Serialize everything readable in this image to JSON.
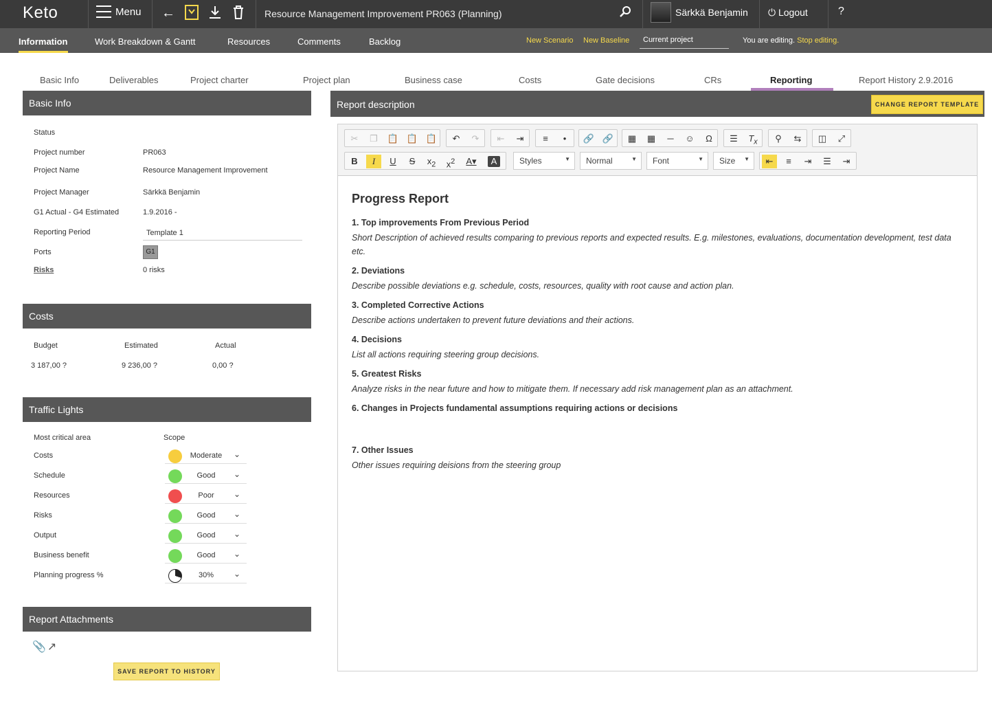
{
  "app": {
    "logo": "Keto",
    "menu_label": "Menu",
    "document_title": "Resource Management Improvement  PR063 (Planning)",
    "user_name": "Särkkä Benjamin",
    "logout_label": "Logout",
    "help_label": "?"
  },
  "nav": {
    "items": [
      "Information",
      "Work Breakdown & Gantt",
      "Resources",
      "Comments",
      "Backlog"
    ],
    "new_scenario": "New Scenario",
    "new_baseline": "New Baseline",
    "current_project": "Current project",
    "editing_text": "You are editing.",
    "stop_editing": "Stop editing."
  },
  "subtabs": [
    "Basic Info",
    "Deliverables",
    "Project charter",
    "Project plan",
    "Business case",
    "Costs",
    "Gate decisions",
    "CRs",
    "Reporting",
    "Report History 2.9.2016"
  ],
  "basic_info": {
    "title": "Basic Info",
    "status_label": "Status",
    "project_number_label": "Project number",
    "project_number": "PR063",
    "project_name_label": "Project Name",
    "project_name": "Resource Management Improvement",
    "project_manager_label": "Project Manager",
    "project_manager": "Särkkä Benjamin",
    "g1_label": "G1 Actual - G4 Estimated",
    "g1_value": "1.9.2016 -",
    "reporting_period_label": "Reporting Period",
    "reporting_period": "Template 1",
    "ports_label": "Ports",
    "port": "G1",
    "risks_label": "Risks",
    "risks_value": "0 risks"
  },
  "costs": {
    "title": "Costs",
    "budget_label": "Budget",
    "estimated_label": "Estimated",
    "actual_label": "Actual",
    "budget": "3 187,00 ?",
    "estimated": "9 236,00 ?",
    "actual": "0,00 ?"
  },
  "traffic": {
    "title": "Traffic Lights",
    "area_header": "Most critical area",
    "scope_header": "Scope",
    "rows": [
      {
        "label": "Costs",
        "value": "Moderate",
        "color": "#f7cd3e"
      },
      {
        "label": "Schedule",
        "value": "Good",
        "color": "#74d95a"
      },
      {
        "label": "Resources",
        "value": "Poor",
        "color": "#f04e4e"
      },
      {
        "label": "Risks",
        "value": "Good",
        "color": "#74d95a"
      },
      {
        "label": "Output",
        "value": "Good",
        "color": "#74d95a"
      },
      {
        "label": "Business benefit",
        "value": "Good",
        "color": "#74d95a"
      }
    ],
    "progress_label": "Planning progress %",
    "progress_value": "30%",
    "progress_fraction": 0.3
  },
  "attachments": {
    "title": "Report Attachments",
    "save_label": "SAVE REPORT TO HISTORY"
  },
  "report": {
    "title": "Report description",
    "change_template_label": "CHANGE REPORT TEMPLATE",
    "styles_label": "Styles",
    "format_label": "Normal",
    "font_label": "Font",
    "size_label": "Size",
    "heading": "Progress Report",
    "sections": [
      {
        "title": "1. Top improvements From Previous Period",
        "text": "Short Description of achieved results comparing to previous reports and expected results. E.g. milestones, evaluations, documentation development, test data etc."
      },
      {
        "title": "2. Deviations",
        "text": "Describe possible deviations e.g. schedule, costs, resources, quality with root cause and action plan."
      },
      {
        "title": "3. Completed Corrective Actions",
        "text": "Describe actions undertaken to prevent future deviations and their actions."
      },
      {
        "title": "4. Decisions",
        "text": "List all actions requiring steering group decisions."
      },
      {
        "title": "5. Greatest Risks",
        "text": "Analyze risks in the near future and how to mitigate them. If necessary add risk management plan as an attachment."
      },
      {
        "title": "6. Changes in Projects fundamental assumptions requiring actions or decisions",
        "text": ""
      },
      {
        "title": "7. Other Issues",
        "text": "Other issues requiring deisions from the steering group"
      }
    ]
  }
}
